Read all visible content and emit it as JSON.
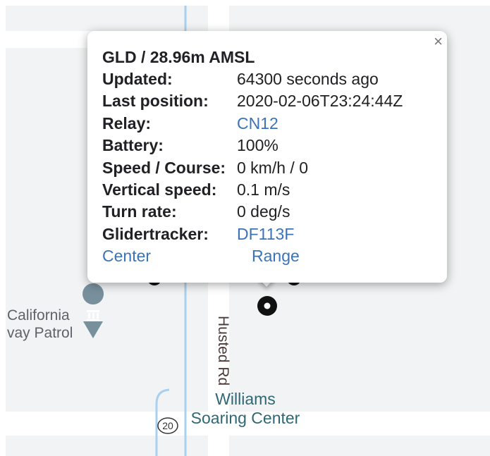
{
  "popup": {
    "title": "GLD / 28.96m AMSL",
    "close_label": "×",
    "rows": [
      {
        "key": "Updated:",
        "value": "64300 seconds ago",
        "link": false
      },
      {
        "key": "Last position:",
        "value": "2020-02-06T23:24:44Z",
        "link": false
      },
      {
        "key": "Relay:",
        "value": "CN12",
        "link": true
      },
      {
        "key": "Battery:",
        "value": "100%",
        "link": false
      },
      {
        "key": "Speed / Course:",
        "value": "0 km/h / 0",
        "link": false
      },
      {
        "key": "Vertical speed:",
        "value": "0.1 m/s",
        "link": false
      },
      {
        "key": "Turn rate:",
        "value": "0 deg/s",
        "link": false
      },
      {
        "key": "Glidertracker:",
        "value": "DF113F",
        "link": true
      }
    ],
    "center_link": "Center",
    "range_link": "Range"
  },
  "map": {
    "poi_line1": "California",
    "poi_line2": "vay Patrol",
    "road_label": "Husted Rd",
    "place_line1": "Williams",
    "place_line2": "Soaring Center",
    "route_shield": "20",
    "colors": {
      "water": "#a8d0f0",
      "poi_icon": "#78909c",
      "place_text": "#2f6775",
      "link": "#3b73b9"
    }
  }
}
